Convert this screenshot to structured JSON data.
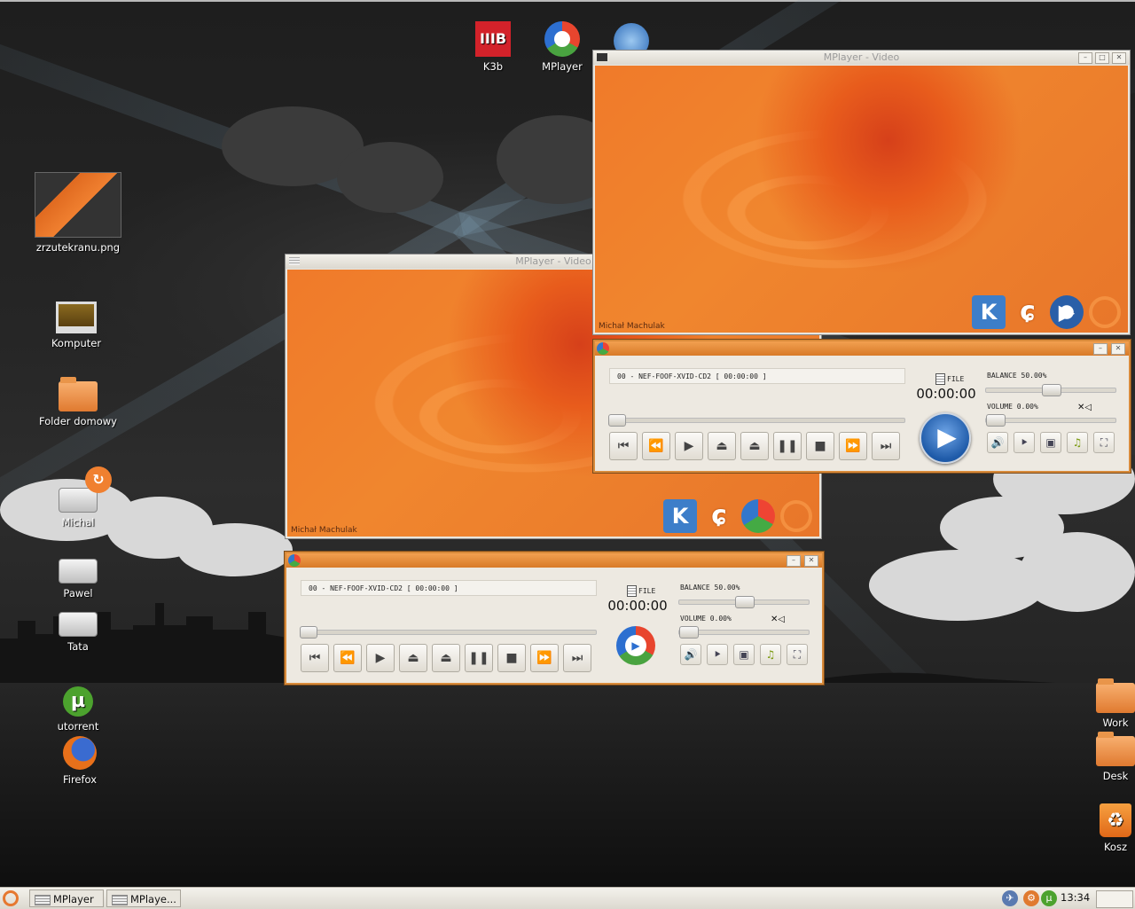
{
  "desktop": {
    "top_icons": [
      {
        "label": "K3b",
        "icon": "k3b-icon"
      },
      {
        "label": "MPlayer",
        "icon": "mplayer-icon"
      },
      {
        "label": "",
        "icon": "wolf-icon"
      }
    ],
    "left_icons": [
      {
        "label": "zrzutekranu.png",
        "icon": "image-thumbnail-icon"
      },
      {
        "label": "Komputer",
        "icon": "computer-icon"
      },
      {
        "label": "Folder domowy",
        "icon": "home-folder-icon"
      },
      {
        "label": "Michal",
        "icon": "drive-icon"
      },
      {
        "label": "Pawel",
        "icon": "drive-icon"
      },
      {
        "label": "Tata",
        "icon": "drive-icon"
      },
      {
        "label": "utorrent",
        "icon": "utorrent-icon"
      },
      {
        "label": "Firefox",
        "icon": "firefox-icon"
      }
    ],
    "right_icons": [
      {
        "label": "Work",
        "icon": "folder-icon"
      },
      {
        "label": "Desk",
        "icon": "folder-icon"
      },
      {
        "label": "Kosz",
        "icon": "trash-icon"
      }
    ]
  },
  "video_window_1": {
    "title": "MPlayer - Video",
    "credit": "Michał Machulak",
    "logos": [
      "kde-logo",
      "gnome-logo",
      "play-logo",
      "ubuntu-logo"
    ]
  },
  "video_window_2": {
    "title": "MPlayer - Video",
    "credit": "Michał Machulak",
    "logos": [
      "kde-logo",
      "gnome-logo",
      "mplayer-logo",
      "ubuntu-logo"
    ]
  },
  "player_1": {
    "track": "00 - NEF-FOOF-XVID-CD2 [ 00:00:00 ]",
    "file_label": "FILE",
    "time": "00:00:00",
    "balance_label": "BALANCE 50.00%",
    "balance": 0.5,
    "volume_label": "VOLUME 0.00%",
    "volume": 0.0,
    "seek": 0.0,
    "mute_symbol": "✕◁"
  },
  "player_2": {
    "track": "00 - NEF-FOOF-XVID-CD2 [ 00:00:00 ]",
    "file_label": "FILE",
    "time": "00:00:00",
    "balance_label": "BALANCE 50.00%",
    "balance": 0.5,
    "volume_label": "VOLUME 0.00%",
    "volume": 0.0,
    "seek": 0.0,
    "mute_symbol": "✕◁"
  },
  "controls": {
    "buttons": [
      "⏮",
      "⏪",
      "▶",
      "⏏",
      "⏏",
      "❚❚",
      "■",
      "⏩",
      "⏭"
    ],
    "side_buttons": [
      "🔊",
      "⯈",
      "▣",
      "♫",
      "⛶"
    ]
  },
  "taskbar": {
    "tasks": [
      "MPlayer",
      "MPlaye..."
    ],
    "clock": "13:34"
  },
  "colors": {
    "accent_orange": "#d88a3a",
    "video_orange": "#f07a2a",
    "play_blue": "#1e5aa8"
  }
}
